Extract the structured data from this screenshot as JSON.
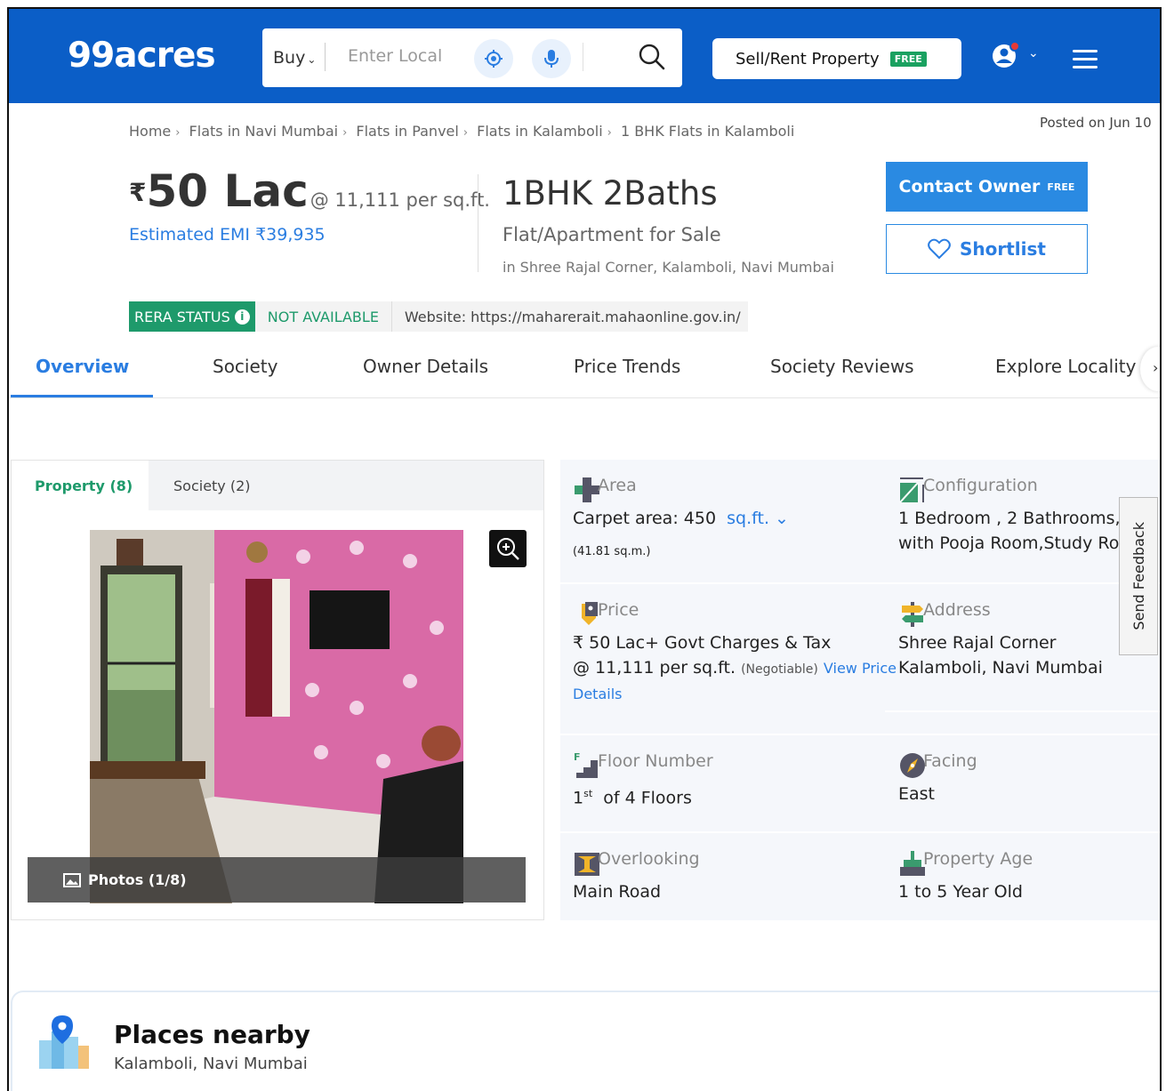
{
  "header": {
    "logo": "99acres",
    "buy_label": "Buy",
    "search_placeholder": "Enter Local",
    "sell_label": "Sell/Rent Property",
    "sell_badge": "FREE"
  },
  "breadcrumb": [
    "Home",
    "Flats in Navi Mumbai",
    "Flats in Panvel",
    "Flats in Kalamboli",
    "1 BHK Flats in Kalamboli"
  ],
  "posted": "Posted on Jun 10",
  "listing": {
    "currency": "₹",
    "price": "50 Lac",
    "per_sqft": "@ 11,111 per sq.ft.",
    "emi": "Estimated EMI ₹39,935",
    "title": "1BHK 2Baths",
    "subtype": "Flat/Apartment for Sale",
    "location": "in Shree Rajal Corner, Kalamboli, Navi Mumbai",
    "contact_label": "Contact Owner",
    "contact_badge": "FREE",
    "shortlist_label": "Shortlist"
  },
  "rera": {
    "status_label": "RERA STATUS",
    "info_glyph": "i",
    "value": "NOT AVAILABLE",
    "website": "Website: https://maharerait.mahaonline.gov.in/"
  },
  "tabs": [
    "Overview",
    "Society",
    "Owner Details",
    "Price Trends",
    "Society Reviews",
    "Explore Locality"
  ],
  "tabs_next_glyph": "›",
  "gallery": {
    "tab_property": "Property (8)",
    "tab_society": "Society (2)",
    "photos_label": "Photos (1/8)"
  },
  "details": {
    "area": {
      "label": "Area",
      "value": "Carpet area: 450",
      "unit": "sq.ft.",
      "unit_chevron": "⌄",
      "sub": "(41.81 sq.m.)"
    },
    "config": {
      "label": "Configuration",
      "line1": "1 Bedroom , 2 Bathrooms,",
      "line2": "with Pooja Room,Study Ro"
    },
    "price": {
      "label": "Price",
      "line1": "₹ 50 Lac+ Govt Charges & Tax",
      "line2": "@ 11,111 per sq.ft.",
      "negotiable": "(Negotiable)",
      "link1": "View Price",
      "link2": "Details"
    },
    "address": {
      "label": "Address",
      "line1": "Shree Rajal Corner",
      "line2": "Kalamboli, Navi Mumbai"
    },
    "floor": {
      "label": "Floor Number",
      "num": "1",
      "sup": "st",
      "rest": "of 4 Floors"
    },
    "facing": {
      "label": "Facing",
      "value": "East"
    },
    "overlooking": {
      "label": "Overlooking",
      "value": "Main Road"
    },
    "age": {
      "label": "Property Age",
      "value": "1 to 5 Year Old"
    }
  },
  "feedback_label": "Send Feedback",
  "places": {
    "title": "Places nearby",
    "sub": "Kalamboli, Navi Mumbai"
  },
  "colors": {
    "brand_blue": "#0b5ec7",
    "accent_blue": "#2a7de1",
    "green": "#1e9a6b"
  }
}
